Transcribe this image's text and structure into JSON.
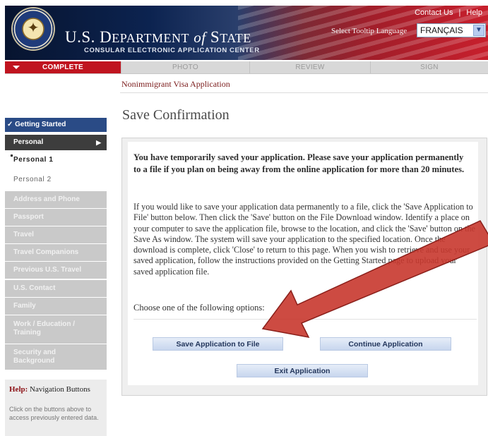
{
  "header": {
    "dept_prefix": "U.S. D",
    "dept_word1": "EPARTMENT",
    "dept_of": "of",
    "dept_word2": "S",
    "dept_word3": "TATE",
    "subtitle": "CONSULAR ELECTRONIC APPLICATION CENTER",
    "links": {
      "contact": "Contact Us",
      "separator": "|",
      "help": "Help"
    },
    "tooltip_language_label": "Select Tooltip Language",
    "tooltip_language_value": "FRANÇAIS",
    "seal_icon": "us-state-department-seal"
  },
  "progress": {
    "steps": [
      {
        "label": "COMPLETE",
        "active": true
      },
      {
        "label": "PHOTO",
        "active": false
      },
      {
        "label": "REVIEW",
        "active": false
      },
      {
        "label": "SIGN",
        "active": false
      }
    ]
  },
  "breadcrumb": "Nonimmigrant Visa Application",
  "sidebar": {
    "items": [
      {
        "label": "✓ Getting Started"
      },
      {
        "label": "Personal"
      },
      {
        "label": "Personal 1"
      },
      {
        "label": "Personal 2"
      },
      {
        "label": "Address and Phone"
      },
      {
        "label": "Passport"
      },
      {
        "label": "Travel"
      },
      {
        "label": "Travel Companions"
      },
      {
        "label": "Previous U.S. Travel"
      },
      {
        "label": "U.S. Contact"
      },
      {
        "label": "Family"
      },
      {
        "label": "Work / Education / Training"
      },
      {
        "label": "Security and Background"
      }
    ],
    "help": {
      "title_bold": "Help:",
      "title_rest": " Navigation Buttons",
      "text": "Click on the buttons above to access previously entered data."
    }
  },
  "main": {
    "title": "Save Confirmation",
    "bold_message": "You have temporarily saved your application. Please save your application permanently to a file if you plan on being away from the online application for more than 20 minutes.",
    "body_message": "If you would like to save your application data permanently to a file, click the 'Save Application to File' button below. Then click the 'Save' button on the File Download window. Identify a place on your computer to save the application file, browse to the location, and click the 'Save' button on the Save As window. The system will save your application to the specified location. Once the download is complete, click 'Close' to return to this page. When you wish to retrieve and use your saved application, follow the instructions provided on the Getting Started page to upload your saved application file.",
    "choose_label": "Choose one of the following options:",
    "buttons": {
      "save": "Save Application to File",
      "continue": "Continue Application",
      "exit": "Exit Application"
    }
  },
  "colors": {
    "accent_red": "#c0141f",
    "nav_blue": "#2a4b86",
    "annotation_arrow": "#c8372e"
  }
}
